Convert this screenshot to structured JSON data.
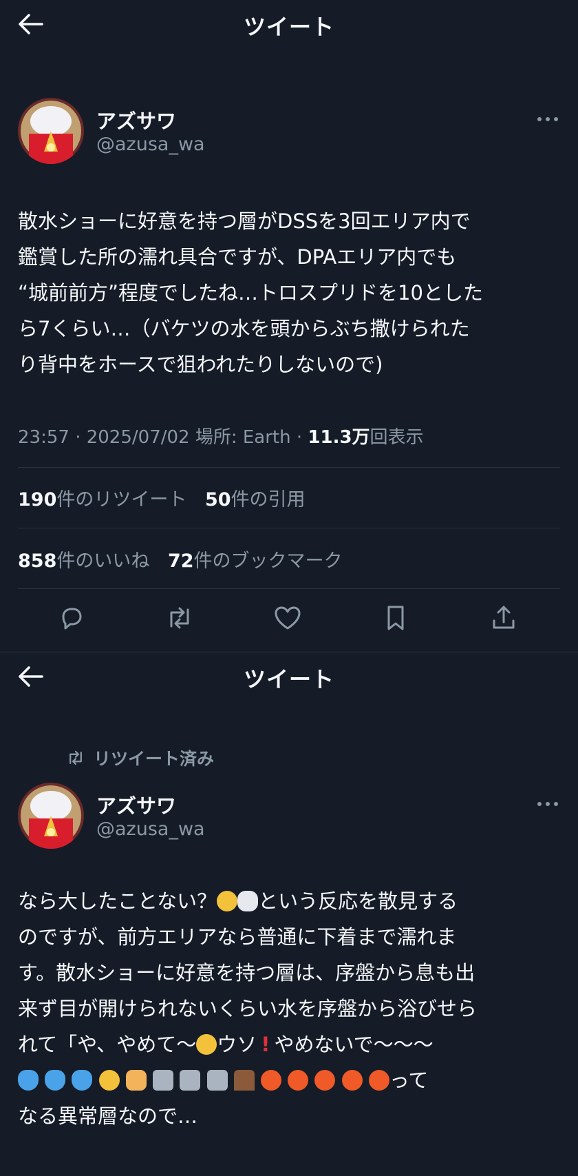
{
  "tweet1": {
    "header_title": "ツイート",
    "author_name": "アズサワ",
    "author_handle": "@azusa_wa",
    "text": "散水ショーに好意を持つ層がDSSを3回エリア内で\n鑑賞した所の濡れ具合ですが、DPAエリア内でも\n“城前前方”程度でしたね…トロスプリドを10とした\nら7くらい…（バケツの水を頭からぶち撒けられた\nり背中をホースで狙われたりしないので)",
    "meta_prefix": "23:57 · 2025/07/02 場所: Earth · ",
    "views_number": "11.3万",
    "views_label": "回表示",
    "retweets_count": "190",
    "retweets_label": "件のリツイート",
    "quotes_count": "50",
    "quotes_label": "件の引用",
    "likes_count": "858",
    "likes_label": "件のいいね",
    "bookmarks_count": "72",
    "bookmarks_label": "件のブックマーク"
  },
  "tweet2": {
    "header_title": "ツイート",
    "retweeted_label": "リツイート済み",
    "author_name": "アズサワ",
    "author_handle": "@azusa_wa",
    "line1": "なら大したことない？",
    "line1_after": "という反応を散見する",
    "line2": "のですが、前方エリアなら普通に下着まで濡れま",
    "line3": "す。散水ショーに好意を持つ層は、序盤から息も出",
    "line4": "来ず目が開けられないくらい水を序盤から浴びせら",
    "line5_a": "れて「や、やめて〜",
    "line5_b": "ウソ",
    "line5_c": "やめないで〜〜〜",
    "line6_after": "って",
    "line7": "なる異常層なので…"
  },
  "icons": [
    "back-arrow-icon",
    "more-icon",
    "reply-icon",
    "retweet-icon",
    "like-icon",
    "bookmark-icon",
    "share-icon"
  ],
  "colors": {
    "background": "#151c27",
    "text": "#f5f7fa",
    "muted": "#8b98a5",
    "divider": "#2c333d"
  }
}
